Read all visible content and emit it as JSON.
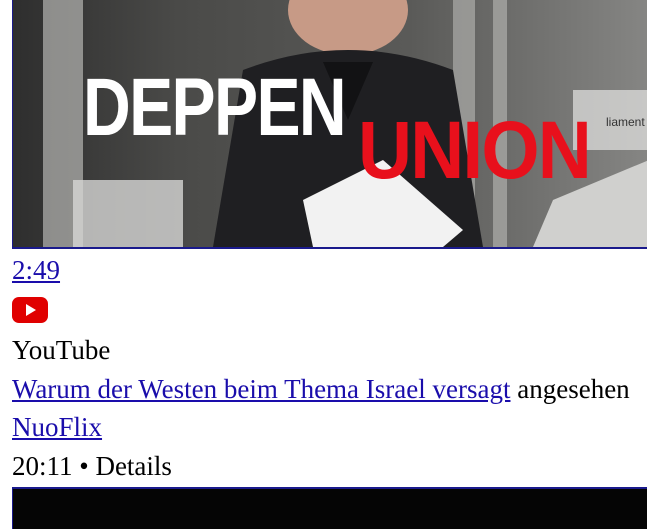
{
  "video1": {
    "thumbnail_text_1": "DEPPEN",
    "thumbnail_text_2": "UNION",
    "thumbnail_sign": "liament",
    "duration": "2:49",
    "platform_icon": "youtube-icon",
    "platform_label": "YouTube"
  },
  "video2": {
    "title": "Warum der Westen beim Thema Israel versagt",
    "status": "angesehen",
    "channel": "NuoFlix",
    "duration": "20:11",
    "separator": "•",
    "details_label": "Details"
  },
  "colors": {
    "link": "#1a0dab",
    "youtube_red": "#e00000",
    "union_red": "#e8101c"
  }
}
